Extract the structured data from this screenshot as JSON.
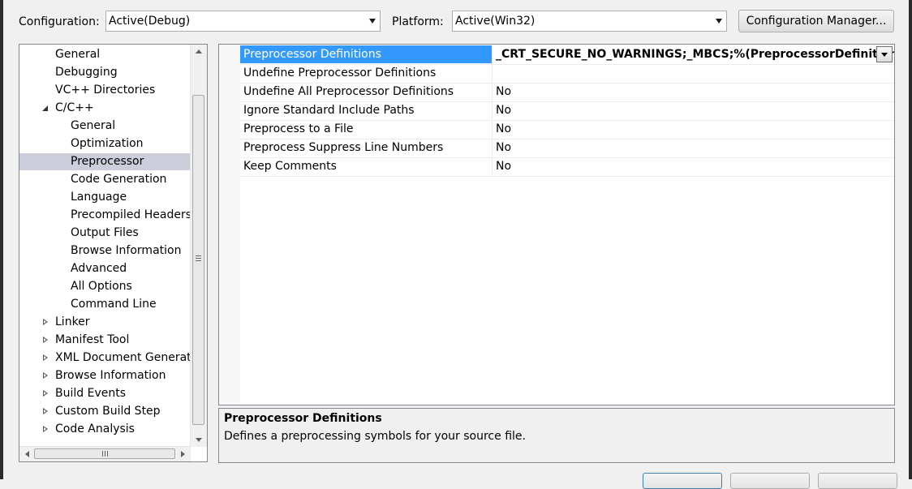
{
  "config": {
    "configuration_label": "Configuration:",
    "configuration_value": "Active(Debug)",
    "platform_label": "Platform:",
    "platform_value": "Active(Win32)",
    "manager_button": "Configuration Manager..."
  },
  "tree": {
    "items": [
      {
        "label": "General",
        "level": 1,
        "expander": "none",
        "selected": false
      },
      {
        "label": "Debugging",
        "level": 1,
        "expander": "none",
        "selected": false
      },
      {
        "label": "VC++ Directories",
        "level": 1,
        "expander": "none",
        "selected": false
      },
      {
        "label": "C/C++",
        "level": 1,
        "expander": "expanded",
        "selected": false
      },
      {
        "label": "General",
        "level": 2,
        "expander": "none",
        "selected": false
      },
      {
        "label": "Optimization",
        "level": 2,
        "expander": "none",
        "selected": false
      },
      {
        "label": "Preprocessor",
        "level": 2,
        "expander": "none",
        "selected": true
      },
      {
        "label": "Code Generation",
        "level": 2,
        "expander": "none",
        "selected": false
      },
      {
        "label": "Language",
        "level": 2,
        "expander": "none",
        "selected": false
      },
      {
        "label": "Precompiled Headers",
        "level": 2,
        "expander": "none",
        "selected": false
      },
      {
        "label": "Output Files",
        "level": 2,
        "expander": "none",
        "selected": false
      },
      {
        "label": "Browse Information",
        "level": 2,
        "expander": "none",
        "selected": false
      },
      {
        "label": "Advanced",
        "level": 2,
        "expander": "none",
        "selected": false
      },
      {
        "label": "All Options",
        "level": 2,
        "expander": "none",
        "selected": false
      },
      {
        "label": "Command Line",
        "level": 2,
        "expander": "none",
        "selected": false
      },
      {
        "label": "Linker",
        "level": 1,
        "expander": "collapsed",
        "selected": false
      },
      {
        "label": "Manifest Tool",
        "level": 1,
        "expander": "collapsed",
        "selected": false
      },
      {
        "label": "XML Document Generato",
        "level": 1,
        "expander": "collapsed",
        "selected": false
      },
      {
        "label": "Browse Information",
        "level": 1,
        "expander": "collapsed",
        "selected": false
      },
      {
        "label": "Build Events",
        "level": 1,
        "expander": "collapsed",
        "selected": false
      },
      {
        "label": "Custom Build Step",
        "level": 1,
        "expander": "collapsed",
        "selected": false
      },
      {
        "label": "Code Analysis",
        "level": 1,
        "expander": "collapsed",
        "selected": false
      }
    ]
  },
  "grid": {
    "rows": [
      {
        "name": "Preprocessor Definitions",
        "value": "_CRT_SECURE_NO_WARNINGS;_MBCS;%(PreprocessorDefinitions)",
        "selected": true
      },
      {
        "name": "Undefine Preprocessor Definitions",
        "value": "",
        "selected": false
      },
      {
        "name": "Undefine All Preprocessor Definitions",
        "value": "No",
        "selected": false
      },
      {
        "name": "Ignore Standard Include Paths",
        "value": "No",
        "selected": false
      },
      {
        "name": "Preprocess to a File",
        "value": "No",
        "selected": false
      },
      {
        "name": "Preprocess Suppress Line Numbers",
        "value": "No",
        "selected": false
      },
      {
        "name": "Keep Comments",
        "value": "No",
        "selected": false
      }
    ]
  },
  "description": {
    "title": "Preprocessor Definitions",
    "text": "Defines a preprocessing symbols for your source file."
  },
  "colors": {
    "selection_blue": "#3399ff",
    "tree_selection": "#cccedb",
    "dialog_bg": "#f0f0f0"
  }
}
